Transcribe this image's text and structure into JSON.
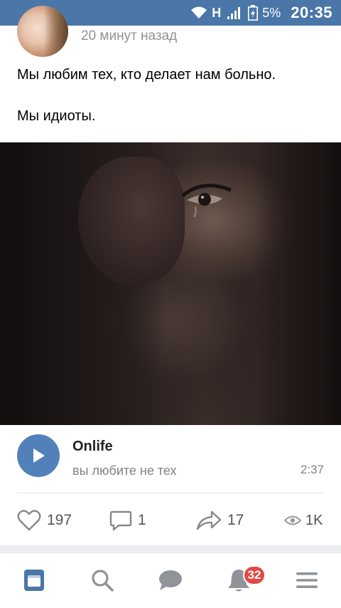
{
  "status_bar": {
    "network_type": "H",
    "battery_percent": "5%",
    "time": "20:35",
    "icons": [
      "wifi-icon",
      "signal-icon",
      "battery-icon"
    ],
    "color": "#4a76a8"
  },
  "post": {
    "time_ago": "20 минут назад",
    "text_line1": "Мы любим тех, кто делает нам больно.",
    "text_line2": "Мы идиоты.",
    "audio": {
      "title": "Onlife",
      "artist": "вы любите не тех",
      "duration": "2:37",
      "play_icon": "play-icon",
      "button_color": "#5181b8"
    },
    "actions": {
      "likes": "197",
      "comments": "1",
      "shares": "17",
      "views": "1K"
    }
  },
  "bottom_nav": {
    "items": [
      "news-icon",
      "search-icon",
      "messages-icon",
      "notifications-icon",
      "menu-icon"
    ],
    "active": "news-icon",
    "notifications_badge": "32",
    "accent": "#4a76a8",
    "badge_color": "#e64646"
  }
}
